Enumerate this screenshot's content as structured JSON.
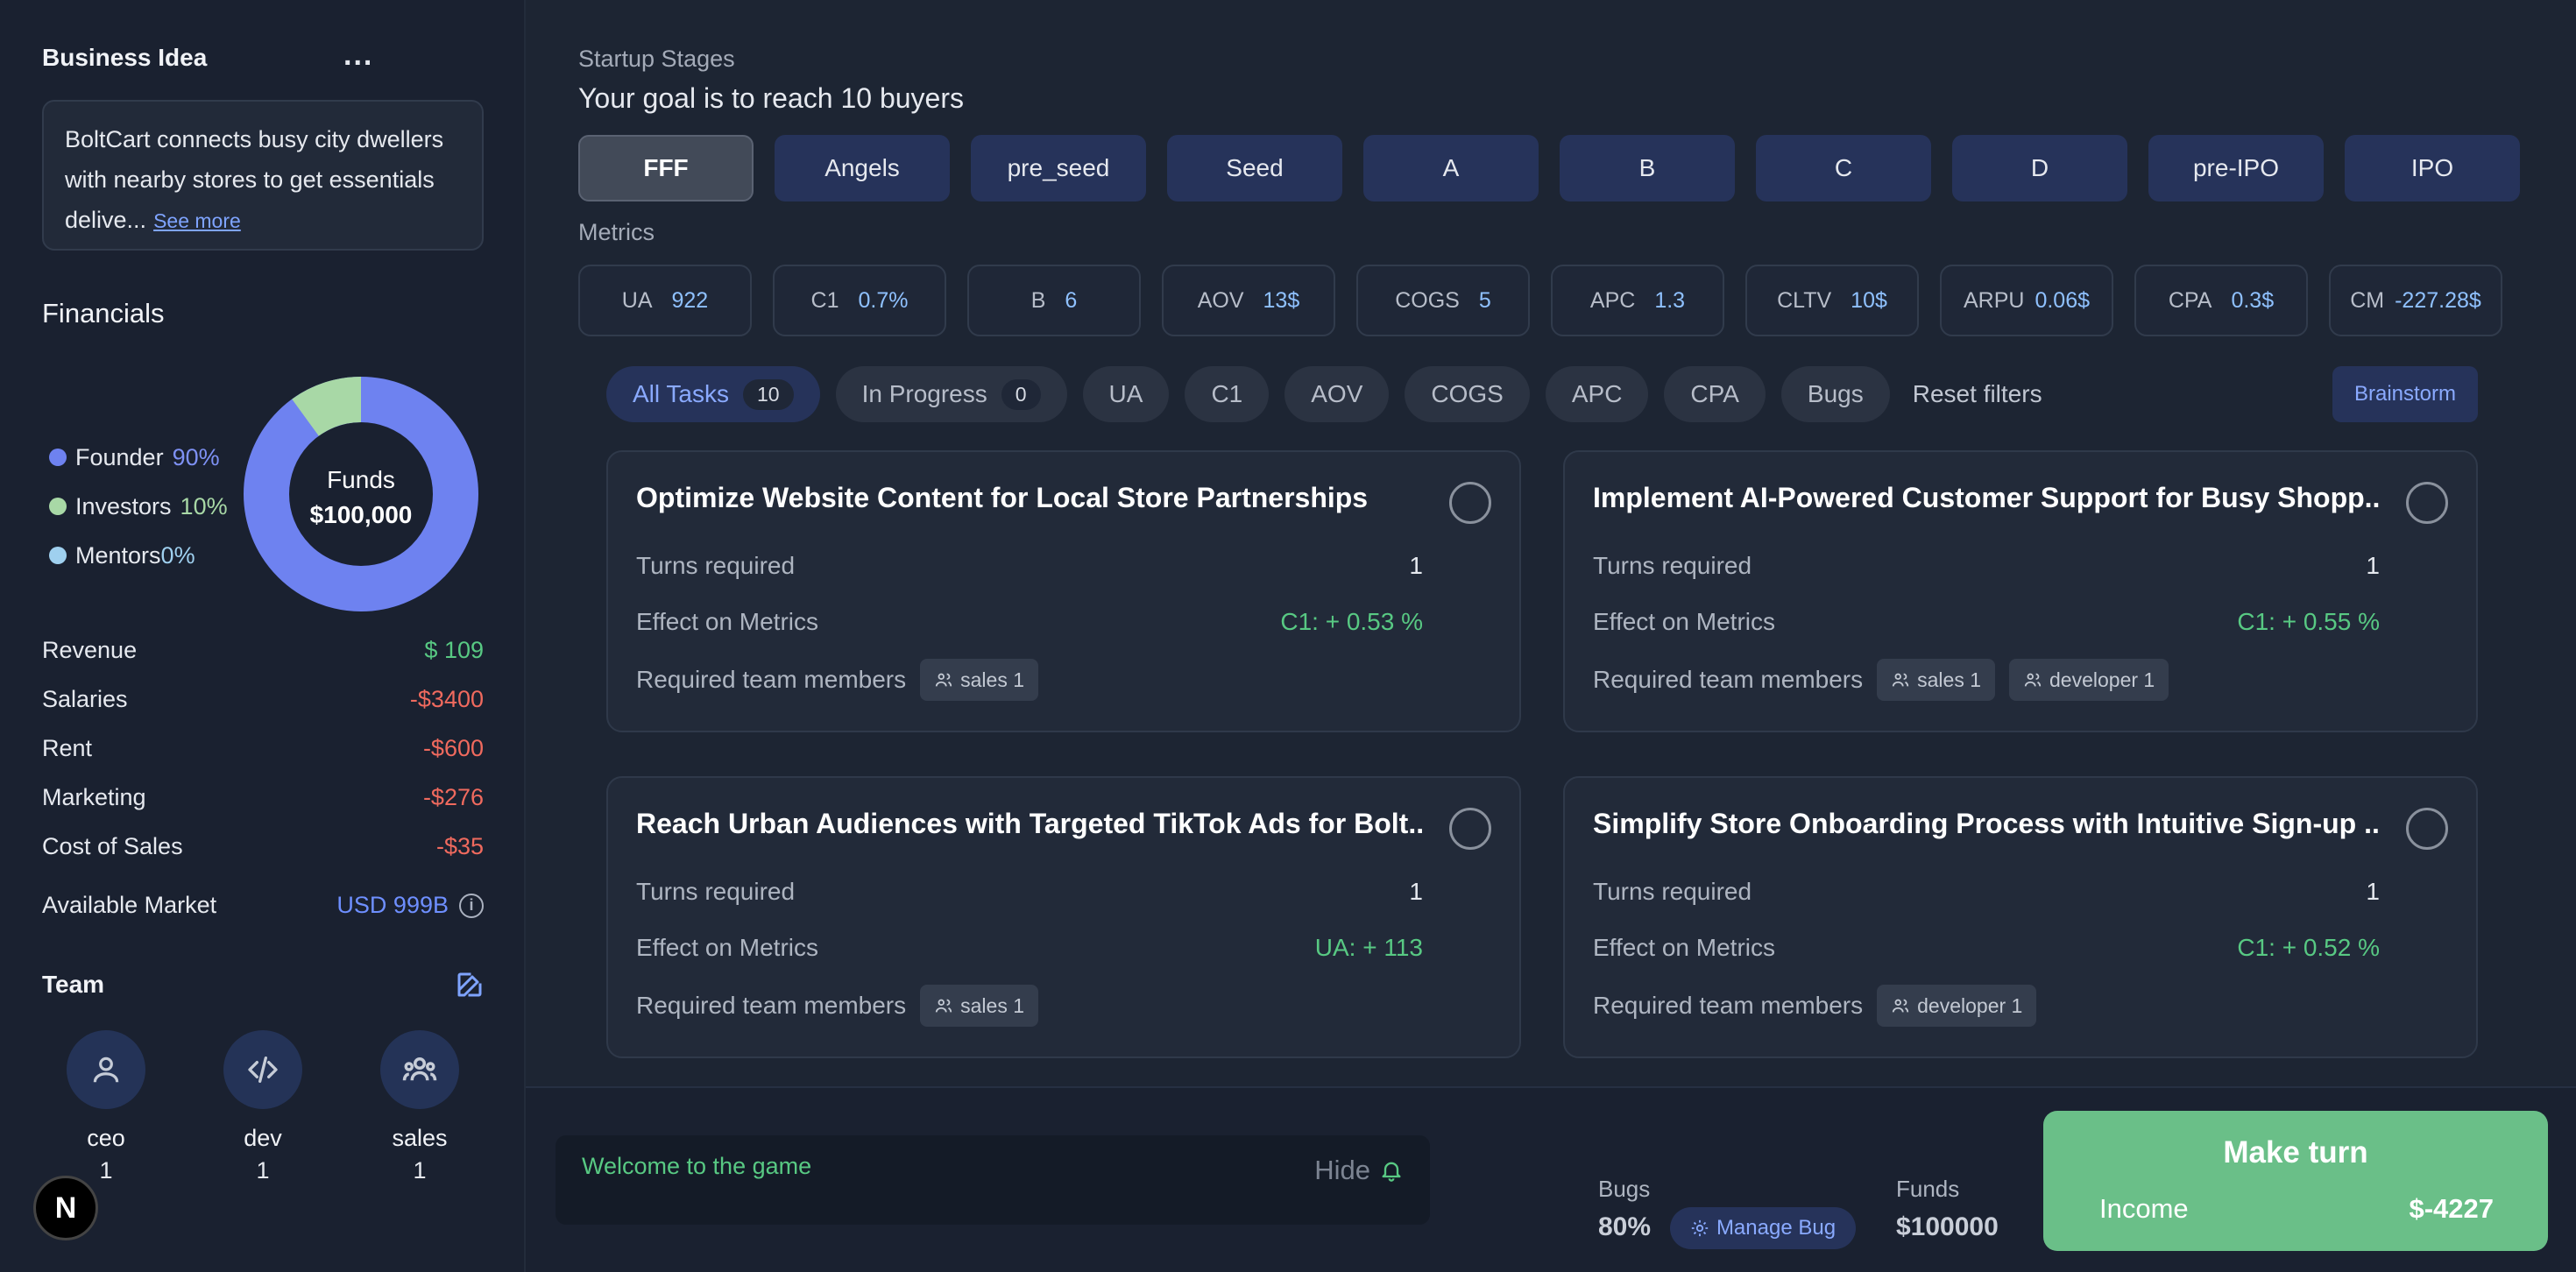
{
  "sidebar": {
    "business_idea": {
      "title": "Business Idea",
      "more": "...",
      "text": "BoltCart connects busy city dwellers with nearby stores to get essentials delive...",
      "see_more": "See more"
    },
    "financials": {
      "title": "Financials",
      "legend": [
        {
          "label": "Founder",
          "pct": "90%",
          "color": "#6e82f0"
        },
        {
          "label": "Investors",
          "pct": "10%",
          "color": "#a8d8a6"
        },
        {
          "label": "Mentors",
          "pct": "0%",
          "color": "#9fd0ef"
        }
      ],
      "donut": {
        "label": "Funds",
        "amount": "$100,000",
        "shares": [
          90,
          10,
          0
        ]
      },
      "rows": [
        {
          "label": "Revenue",
          "value": "$ 109"
        },
        {
          "label": "Salaries",
          "value": "-$3400"
        },
        {
          "label": "Rent",
          "value": "-$600"
        },
        {
          "label": "Marketing",
          "value": "-$276"
        },
        {
          "label": "Cost of Sales",
          "value": "-$35"
        }
      ],
      "available_market_label": "Available Market",
      "available_market_value": "USD 999B",
      "info": "i"
    },
    "team": {
      "title": "Team",
      "members": [
        {
          "role": "ceo",
          "count": "1",
          "icon": "user-icon"
        },
        {
          "role": "dev",
          "count": "1",
          "icon": "code-icon"
        },
        {
          "role": "sales",
          "count": "1",
          "icon": "users-group-icon"
        }
      ]
    },
    "logo": "N"
  },
  "main": {
    "stages_label": "Startup Stages",
    "goal": "Your goal is to reach 10 buyers",
    "stages": [
      "FFF",
      "Angels",
      "pre_seed",
      "Seed",
      "A",
      "B",
      "C",
      "D",
      "pre-IPO",
      "IPO"
    ],
    "active_stage": "FFF",
    "metrics_label": "Metrics",
    "metrics": [
      {
        "name": "UA",
        "value": "922"
      },
      {
        "name": "C1",
        "value": "0.7%"
      },
      {
        "name": "B",
        "value": "6"
      },
      {
        "name": "AOV",
        "value": "13$"
      },
      {
        "name": "COGS",
        "value": "5"
      },
      {
        "name": "APC",
        "value": "1.3"
      },
      {
        "name": "CLTV",
        "value": "10$"
      },
      {
        "name": "ARPU",
        "value": "0.06$"
      },
      {
        "name": "CPA",
        "value": "0.3$"
      },
      {
        "name": "CM",
        "value": "-227.28$"
      }
    ],
    "filters": {
      "all_tasks": "All Tasks",
      "all_tasks_count": "10",
      "in_progress": "In Progress",
      "in_progress_count": "0",
      "tags": [
        "UA",
        "C1",
        "AOV",
        "COGS",
        "APC",
        "CPA",
        "Bugs"
      ],
      "reset": "Reset filters",
      "brainstorm": "Brainstorm"
    },
    "task_labels": {
      "turns": "Turns required",
      "effect": "Effect on Metrics",
      "members": "Required team members"
    },
    "tasks": [
      {
        "title": "Optimize Website Content for Local Store Partnerships",
        "turns": "1",
        "effect": "C1: + 0.53 %",
        "members": [
          "sales 1"
        ]
      },
      {
        "title": "Implement AI-Powered Customer Support for Busy Shopp...",
        "turns": "1",
        "effect": "C1: + 0.55 %",
        "members": [
          "sales 1",
          "developer 1"
        ]
      },
      {
        "title": "Reach Urban Audiences with Targeted TikTok Ads for Bolt...",
        "turns": "1",
        "effect": "UA: + 113",
        "members": [
          "sales 1"
        ]
      },
      {
        "title": "Simplify Store Onboarding Process with Intuitive Sign-up ...",
        "turns": "1",
        "effect": "C1: + 0.52 %",
        "members": [
          "developer 1"
        ]
      }
    ]
  },
  "bottom": {
    "welcome": "Welcome to the game",
    "hide": "Hide",
    "bugs_label": "Bugs",
    "bugs_value": "80%",
    "manage_bug": "Manage Bug",
    "funds_label": "Funds",
    "funds_value": "$100000",
    "make_turn": "Make turn",
    "income_label": "Income",
    "income_value": "$-4227"
  }
}
